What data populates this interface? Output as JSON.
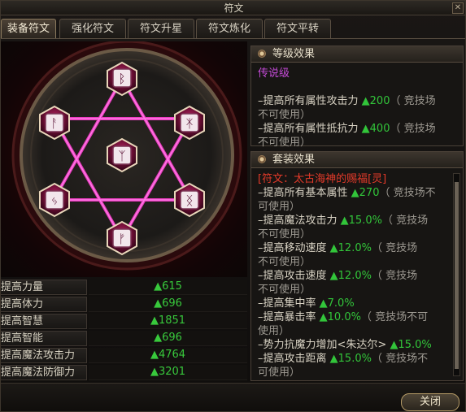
{
  "window": {
    "title": "符文",
    "close_glyph": "✕"
  },
  "tabs": [
    {
      "label": "装备符文"
    },
    {
      "label": "强化符文"
    },
    {
      "label": "符文升星"
    },
    {
      "label": "符文炼化"
    },
    {
      "label": "符文平转"
    }
  ],
  "runes": [
    {
      "glyph": "ᛒ"
    },
    {
      "glyph": "ᚨ"
    },
    {
      "glyph": "ᛡ"
    },
    {
      "glyph": "ᛉ"
    },
    {
      "glyph": "ᛃ"
    },
    {
      "glyph": "ᛝ"
    },
    {
      "glyph": "ᚠ"
    }
  ],
  "stats": [
    {
      "name": "提高力量",
      "value": "▲615"
    },
    {
      "name": "提高体力",
      "value": "▲696"
    },
    {
      "name": "提高智慧",
      "value": "▲1851"
    },
    {
      "name": "提高智能",
      "value": "▲696"
    },
    {
      "name": "提高魔法攻击力",
      "value": "▲4764"
    },
    {
      "name": "提高魔法防御力",
      "value": "▲3201"
    }
  ],
  "level_effect": {
    "title": "等级效果",
    "grade": "传说级",
    "lines": [
      {
        "text": "–提高所有属性攻击力",
        "value": "▲200",
        "note": "（ 竞技场",
        "note2": "不可使用）"
      },
      {
        "text": "–提高所有属性抵抗力",
        "value": "▲400",
        "note": "（ 竞技场",
        "note2": "不可使用）"
      }
    ]
  },
  "set_effect": {
    "title": "套装效果",
    "set_name": "[符文：太古海神的赐福[灵]",
    "lines": [
      {
        "text": "–提高所有基本属性",
        "value": "▲270",
        "note": "（ 竞技场不",
        "note2": "可使用）"
      },
      {
        "text": "–提高魔法攻击力",
        "value": "▲15.0%",
        "note": "（ 竞技场",
        "note2": "不可使用）"
      },
      {
        "text": "–提高移动速度",
        "value": "▲12.0%",
        "note": "（ 竞技场",
        "note2": "不可使用）"
      },
      {
        "text": "–提高攻击速度",
        "value": "▲12.0%",
        "note": "（ 竞技场",
        "note2": "不可使用）"
      },
      {
        "text": "–提高集中率",
        "value": "▲7.0%",
        "note": "",
        "note2": ""
      },
      {
        "text": "–提高暴击率",
        "value": "▲10.0%",
        "note": "（ 竞技场不可",
        "note2": "使用）"
      },
      {
        "text": "–势力抗魔力增加<朱达尔>",
        "value": "▲15.0%",
        "note": "",
        "note2": ""
      },
      {
        "text": "–提高攻击距离",
        "value": "▲15.0%",
        "note": "（ 竞技场不",
        "note2": "可使用）"
      }
    ]
  },
  "buttons": {
    "close": "关闭"
  },
  "colors": {
    "accent_green": "#32c53a",
    "legend_purple": "#c54bd8",
    "set_red": "#e43a2a",
    "rune_pink": "#ff3fd0"
  }
}
